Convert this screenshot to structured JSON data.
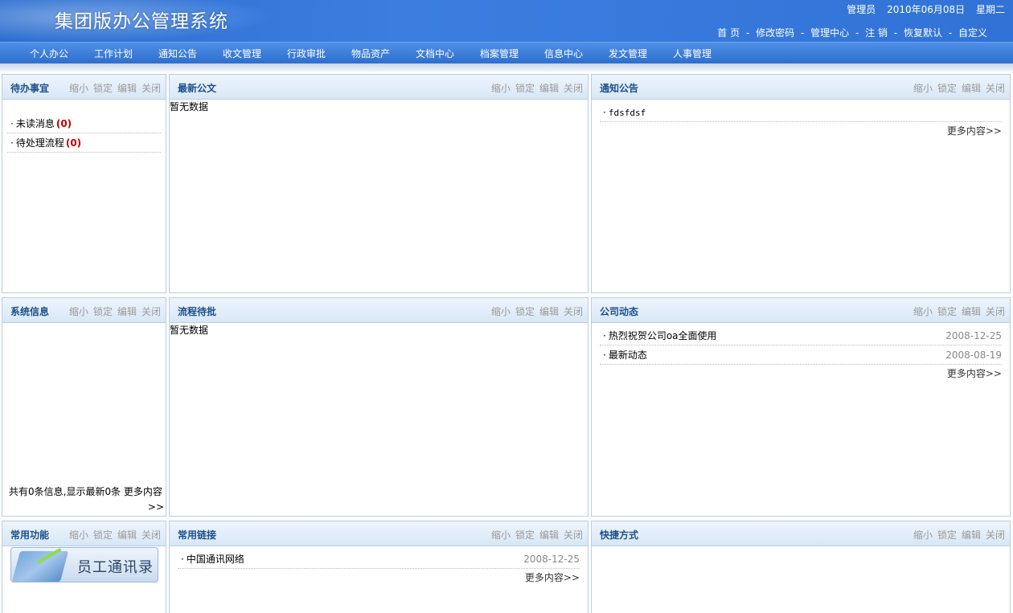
{
  "header": {
    "app_title": "集团版办公管理系统",
    "user": "管理员",
    "date": "2010年06月08日",
    "weekday": "星期二",
    "links": [
      "首 页",
      "修改密码",
      "管理中心",
      "注 销",
      "恢复默认",
      "自定义"
    ],
    "separator": "-"
  },
  "nav": {
    "items": [
      "个人办公",
      "工作计划",
      "通知公告",
      "收文管理",
      "行政审批",
      "物品资产",
      "文档中心",
      "档案管理",
      "信息中心",
      "发文管理",
      "人事管理"
    ]
  },
  "panel_controls": [
    "缩小",
    "锁定",
    "编辑",
    "关闭"
  ],
  "panels": {
    "todo": {
      "title": "待办事宜",
      "items": [
        {
          "label": "未读消息",
          "count": "(0)"
        },
        {
          "label": "待处理流程",
          "count": "(0)"
        }
      ]
    },
    "latest_docs": {
      "title": "最新公文",
      "empty": "暂无数据"
    },
    "notices": {
      "title": "通知公告",
      "items": [
        {
          "label": "fdsfdsf"
        }
      ],
      "more": "更多内容>>"
    },
    "sysinfo": {
      "title": "系统信息",
      "summary": "共有0条信息,显示最新0条  更多内容",
      "more": ">>"
    },
    "workflow": {
      "title": "流程待批",
      "empty": "暂无数据"
    },
    "company_news": {
      "title": "公司动态",
      "items": [
        {
          "label": "热烈祝贺公司oa全面使用",
          "date": "2008-12-25"
        },
        {
          "label": "最新动态",
          "date": "2008-08-19"
        }
      ],
      "more": "更多内容>>"
    },
    "functions": {
      "title": "常用功能",
      "contact_button": "员工通讯录"
    },
    "links": {
      "title": "常用链接",
      "items": [
        {
          "label": "中国通讯网络",
          "date": "2008-12-25"
        }
      ],
      "more": "更多内容>>"
    },
    "shortcuts": {
      "title": "快捷方式"
    }
  },
  "bullet": "·"
}
